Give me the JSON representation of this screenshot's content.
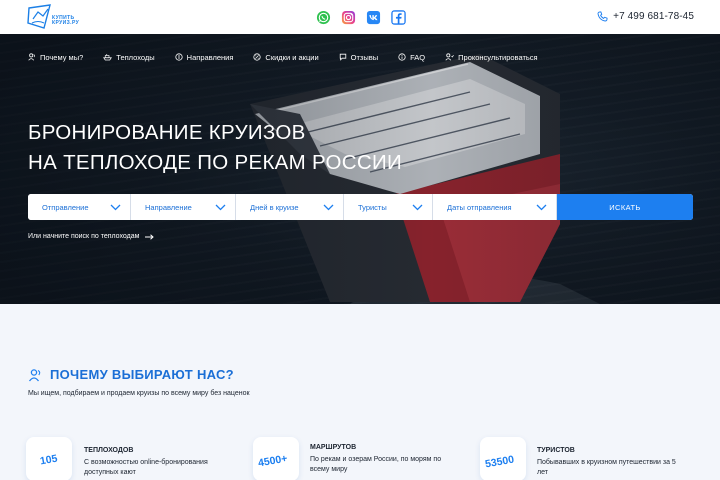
{
  "header": {
    "logo_text_line1": "КУПИТЬ",
    "logo_text_line2": "КРУИЗ.РУ",
    "social_icons": [
      "whatsapp-icon",
      "instagram-icon",
      "vk-icon",
      "facebook-icon"
    ],
    "phone": "+7 499 681-78-45",
    "colors": {
      "accent": "#1d7ff0",
      "whatsapp": "#2fc14f",
      "instagram": "#e8418f",
      "vk": "#2787f5",
      "facebook": "#1877f2"
    }
  },
  "nav": {
    "items": [
      {
        "label": "Почему мы?",
        "icon": "people-icon"
      },
      {
        "label": "Теплоходы",
        "icon": "ship-icon"
      },
      {
        "label": "Направления",
        "icon": "compass-icon"
      },
      {
        "label": "Скидки и акции",
        "icon": "discount-icon"
      },
      {
        "label": "Отзывы",
        "icon": "chat-icon"
      },
      {
        "label": "FAQ",
        "icon": "info-icon"
      },
      {
        "label": "Проконсультироваться",
        "icon": "support-icon"
      }
    ]
  },
  "hero": {
    "title_line1": "БРОНИРОВАНИЕ КРУИЗОВ",
    "title_line2": "НА ТЕПЛОХОДЕ ПО РЕКАМ РОССИИ"
  },
  "search": {
    "fields": [
      {
        "label": "Отправление"
      },
      {
        "label": "Направление"
      },
      {
        "label": "Дней в круизе"
      },
      {
        "label": "Туристы"
      },
      {
        "label": "Даты отправления"
      }
    ],
    "button_label": "ИСКАТЬ",
    "ship_search_link": "Или начните поиск по теплоходам"
  },
  "why": {
    "title": "ПОЧЕМУ ВЫБИРАЮТ НАС?",
    "subtitle": "Мы ищем, подбираем и продаем круизы по всему миру без наценок",
    "stats": [
      {
        "number": "105",
        "title": "ТЕПЛОХОДОВ",
        "desc": "С возможностью online-бронирования доступных кают"
      },
      {
        "number": "4500+",
        "title": "МАРШРУТОВ",
        "desc": "По рекам и озерам России, по морям по всему миру"
      },
      {
        "number": "53500",
        "title": "ТУРИСТОВ",
        "desc": "Побывавших в круизном путешествии за 5 лет"
      }
    ]
  }
}
